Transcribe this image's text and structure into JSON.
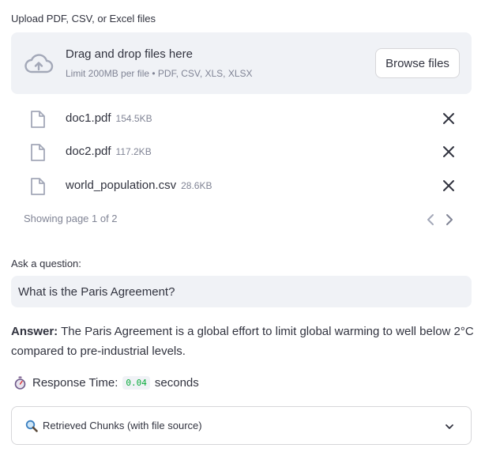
{
  "uploader": {
    "label": "Upload PDF, CSV, or Excel files",
    "dropzone_title": "Drag and drop files here",
    "dropzone_subtitle": "Limit 200MB per file • PDF, CSV, XLS, XLSX",
    "browse_label": "Browse files",
    "files": [
      {
        "name": "doc1.pdf",
        "size": "154.5KB"
      },
      {
        "name": "doc2.pdf",
        "size": "117.2KB"
      },
      {
        "name": "world_population.csv",
        "size": "28.6KB"
      }
    ],
    "pagination": "Showing page 1 of 2"
  },
  "question": {
    "label": "Ask a question:",
    "value": "What is the Paris Agreement?"
  },
  "answer": {
    "prefix": "Answer:",
    "text": " The Paris Agreement is a global effort to limit global warming to well below 2°C compared to pre-industrial levels."
  },
  "response": {
    "emoji": "stopwatch-icon",
    "label": "Response Time:",
    "value": "0.04",
    "unit": "seconds"
  },
  "expander": {
    "icon": "magnifier-icon",
    "label": "Retrieved Chunks (with file source)"
  },
  "colors": {
    "accent_green": "#09ab3b",
    "panel_bg": "#f0f2f6",
    "muted_text": "#808495"
  }
}
